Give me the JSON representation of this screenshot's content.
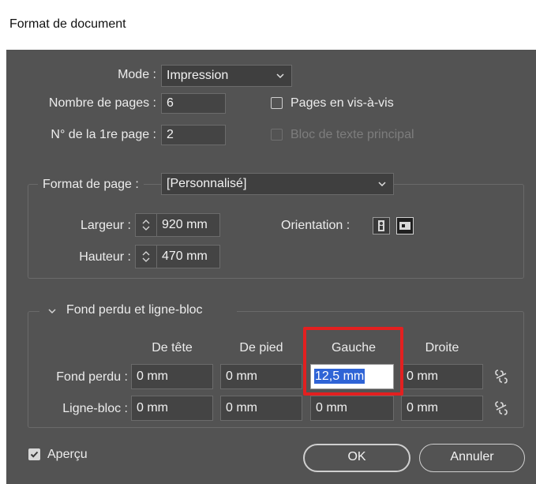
{
  "window": {
    "title": "Format de document"
  },
  "general": {
    "mode_label": "Mode :",
    "mode_value": "Impression",
    "pages_label": "Nombre de pages :",
    "pages_value": "6",
    "first_page_label": "N° de la 1re page :",
    "first_page_value": "2",
    "facing_pages_label": "Pages en vis-à-vis",
    "facing_pages_checked": false,
    "primary_text_label": "Bloc de texte principal",
    "primary_text_enabled": false
  },
  "page_size": {
    "label": "Format de page :",
    "value": "[Personnalisé]",
    "width_label": "Largeur :",
    "width_value": "920 mm",
    "height_label": "Hauteur :",
    "height_value": "470 mm",
    "orientation_label": "Orientation :",
    "orientation_selected": "landscape"
  },
  "bleed": {
    "section_label": "Fond perdu et ligne-bloc",
    "columns": [
      "De tête",
      "De pied",
      "Gauche",
      "Droite"
    ],
    "bleed_label": "Fond perdu :",
    "bleed_values": [
      "0 mm",
      "0 mm",
      "12,5 mm",
      "0 mm"
    ],
    "slug_label": "Ligne-bloc :",
    "slug_values": [
      "0 mm",
      "0 mm",
      "0 mm",
      "0 mm"
    ]
  },
  "footer": {
    "preview_label": "Aperçu",
    "preview_checked": true,
    "ok_label": "OK",
    "cancel_label": "Annuler"
  },
  "colors": {
    "dialog_bg": "#535353",
    "field_bg": "#444444",
    "selection": "#2f64d6",
    "highlight_box": "#e32020"
  }
}
